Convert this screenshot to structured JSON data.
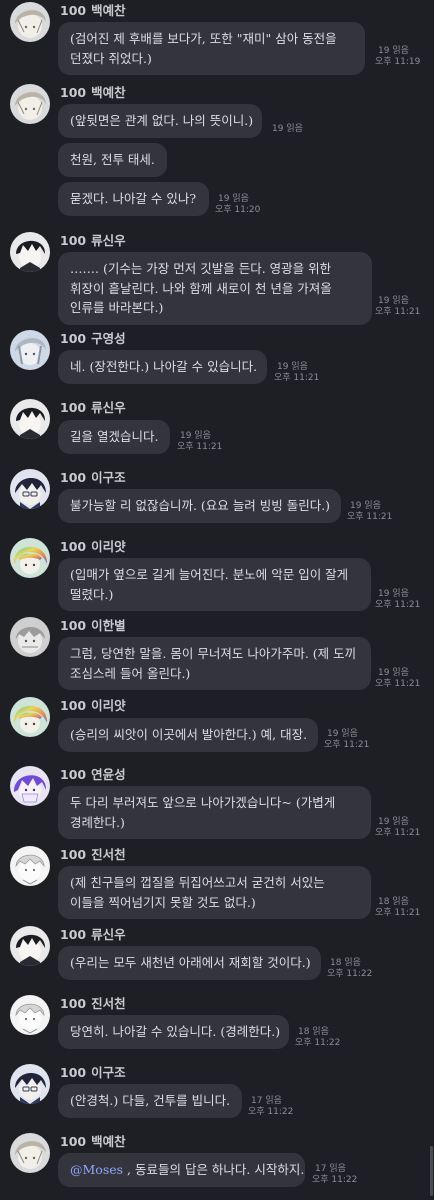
{
  "messages": [
    {
      "level": "100",
      "name": "백예찬",
      "avatar": "avatar-baekyechan",
      "bubbles": [
        {
          "lines": [
            "(검어진 제 후배를 보다가, 또한 \"재미\" 삼아 동전을",
            "던졌다 쥐었다.)"
          ],
          "read": "19 읽음",
          "time": "오후 11:19"
        }
      ]
    },
    {
      "level": "100",
      "name": "백예찬",
      "avatar": "avatar-baekyechan",
      "bubbles": [
        {
          "lines": [
            "(앞뒷면은 관계 없다. 나의 뜻이니.)"
          ],
          "read": "19 읽음",
          "time": ""
        },
        {
          "lines": [
            "천원, 전투 태세."
          ],
          "read": "",
          "time": ""
        },
        {
          "lines": [
            "묻겠다. 나아갈 수 있나?"
          ],
          "read": "19 읽음",
          "time": "오후 11:20"
        }
      ]
    },
    {
      "level": "100",
      "name": "류신우",
      "avatar": "avatar-ryushinwoo",
      "bubbles": [
        {
          "lines": [
            "……. (기수는 가장 먼저 깃발을 든다. 영광을 위한",
            "휘장이 흩날린다. 나와 함께 새로이 천 년을 가져올",
            "인류를 바라본다.)"
          ],
          "read": "19 읽음",
          "time": "오후 11:21"
        }
      ]
    },
    {
      "level": "100",
      "name": "구영성",
      "avatar": "avatar-guyeongseong",
      "bubbles": [
        {
          "lines": [
            "네. (장전한다.) 나아갈 수 있습니다."
          ],
          "read": "19 읽음",
          "time": "오후 11:21"
        }
      ]
    },
    {
      "level": "100",
      "name": "류신우",
      "avatar": "avatar-ryushinwoo",
      "bubbles": [
        {
          "lines": [
            "길을 열겠습니다."
          ],
          "read": "19 읽음",
          "time": "오후 11:21"
        }
      ]
    },
    {
      "level": "100",
      "name": "이구조",
      "avatar": "avatar-igujo",
      "bubbles": [
        {
          "lines": [
            "불가능할 리 없잖습니까. (요요 늘려 빙빙 돌린다.)"
          ],
          "read": "19 읽음",
          "time": "오후 11:21"
        }
      ]
    },
    {
      "level": "100",
      "name": "이리얏",
      "avatar": "avatar-iriyat",
      "bubbles": [
        {
          "lines": [
            "(입매가 옆으로 길게 늘어진다. 분노에 악문 입이 잘게",
            "떨렸다.)"
          ],
          "read": "19 읽음",
          "time": "오후 11:21"
        }
      ]
    },
    {
      "level": "100",
      "name": "이한별",
      "avatar": "avatar-ihanbyeol",
      "bubbles": [
        {
          "lines": [
            "그럼, 당연한 말을. 몸이 무너져도 나아가주마. (제 도끼",
            "조심스레 들어 올린다.)"
          ],
          "read": "19 읽음",
          "time": "오후 11:21"
        }
      ]
    },
    {
      "level": "100",
      "name": "이리얏",
      "avatar": "avatar-iriyat",
      "bubbles": [
        {
          "lines": [
            "(승리의 씨앗이 이곳에서 발아한다.) 예, 대장."
          ],
          "read": "19 읽음",
          "time": "오후 11:21"
        }
      ]
    },
    {
      "level": "100",
      "name": "연윤성",
      "avatar": "avatar-yeonyunseong",
      "bubbles": [
        {
          "lines": [
            "두 다리 부러져도 앞으로 나아가겠습니다~ (가볍게",
            "경례한다.)"
          ],
          "read": "19 읽음",
          "time": "오후 11:21"
        }
      ]
    },
    {
      "level": "100",
      "name": "진서천",
      "avatar": "avatar-jinseocheon",
      "bubbles": [
        {
          "lines": [
            "(제 친구들의 껍질을 뒤집어쓰고서 굳건히 서있는",
            "이들을 찍어넘기지 못할 것도 없다.)"
          ],
          "read": "18 읽음",
          "time": "오후 11:21"
        }
      ]
    },
    {
      "level": "100",
      "name": "류신우",
      "avatar": "avatar-ryushinwoo",
      "bubbles": [
        {
          "lines": [
            "(우리는 모두 새천년 아래에서 재회할 것이다.)"
          ],
          "read": "18 읽음",
          "time": "오후 11:22"
        }
      ]
    },
    {
      "level": "100",
      "name": "진서천",
      "avatar": "avatar-jinseocheon",
      "bubbles": [
        {
          "lines": [
            "당연히. 나아갈 수 있습니다. (경례한다.)"
          ],
          "read": "18 읽음",
          "time": "오후 11:22"
        }
      ]
    },
    {
      "level": "100",
      "name": "이구조",
      "avatar": "avatar-igujo",
      "bubbles": [
        {
          "lines": [
            "(안경척.) 다들, 건투를 빕니다."
          ],
          "read": "17 읽음",
          "time": "오후 11:22"
        }
      ]
    },
    {
      "level": "100",
      "name": "백예찬",
      "avatar": "avatar-baekyechan",
      "bubbles": [
        {
          "mention": "@Moses",
          "lines": [
            " , 동료들의 답은 하나다. 시작하지."
          ],
          "read": "17 읽음",
          "time": "오후 11:22"
        }
      ]
    }
  ]
}
